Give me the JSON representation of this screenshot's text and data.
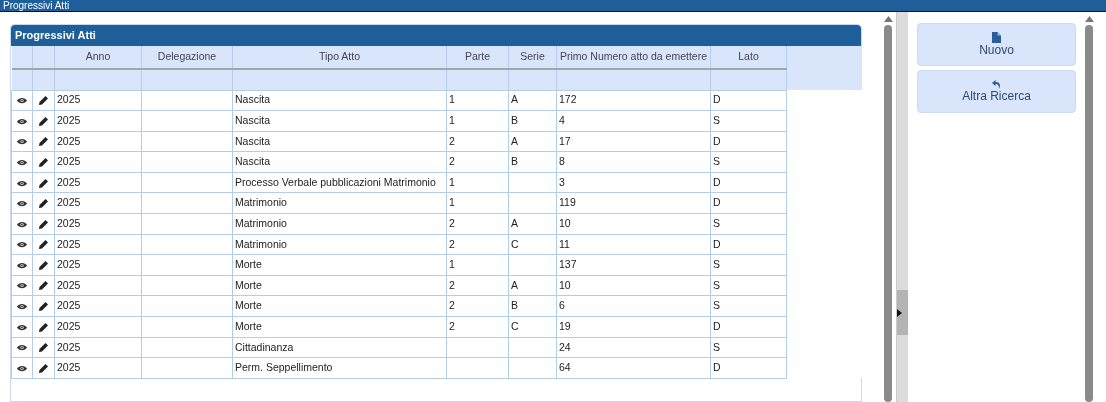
{
  "window": {
    "title": "Progressivi Atti"
  },
  "panel": {
    "title": "Progressivi Atti"
  },
  "table": {
    "columns": [
      "Anno",
      "Delegazione",
      "Tipo Atto",
      "Parte",
      "Serie",
      "Primo Numero atto da emettere",
      "Lato"
    ],
    "rows": [
      {
        "anno": "2025",
        "tipo_atto": "Nascita",
        "parte": "1",
        "serie": "A",
        "primo_numero": "172",
        "lato": "D"
      },
      {
        "anno": "2025",
        "tipo_atto": "Nascita",
        "parte": "1",
        "serie": "B",
        "primo_numero": "4",
        "lato": "S"
      },
      {
        "anno": "2025",
        "tipo_atto": "Nascita",
        "parte": "2",
        "serie": "A",
        "primo_numero": "17",
        "lato": "D"
      },
      {
        "anno": "2025",
        "tipo_atto": "Nascita",
        "parte": "2",
        "serie": "B",
        "primo_numero": "8",
        "lato": "S"
      },
      {
        "anno": "2025",
        "tipo_atto": "Processo Verbale pubblicazioni Matrimonio",
        "parte": "1",
        "primo_numero": "3",
        "lato": "D"
      },
      {
        "anno": "2025",
        "tipo_atto": "Matrimonio",
        "parte": "1",
        "primo_numero": "119",
        "lato": "D"
      },
      {
        "anno": "2025",
        "tipo_atto": "Matrimonio",
        "parte": "2",
        "serie": "A",
        "primo_numero": "10",
        "lato": "S"
      },
      {
        "anno": "2025",
        "tipo_atto": "Matrimonio",
        "parte": "2",
        "serie": "C",
        "primo_numero": "11",
        "lato": "D"
      },
      {
        "anno": "2025",
        "tipo_atto": "Morte",
        "parte": "1",
        "primo_numero": "137",
        "lato": "S"
      },
      {
        "anno": "2025",
        "tipo_atto": "Morte",
        "parte": "2",
        "serie": "A",
        "primo_numero": "10",
        "lato": "S"
      },
      {
        "anno": "2025",
        "tipo_atto": "Morte",
        "parte": "2",
        "serie": "B",
        "primo_numero": "6",
        "lato": "S"
      },
      {
        "anno": "2025",
        "tipo_atto": "Morte",
        "parte": "2",
        "serie": "C",
        "primo_numero": "19",
        "lato": "D"
      },
      {
        "anno": "2025",
        "tipo_atto": "Cittadinanza",
        "primo_numero": "24",
        "lato": "S"
      },
      {
        "anno": "2025",
        "tipo_atto": "Perm. Seppellimento",
        "primo_numero": "64",
        "lato": "D"
      }
    ]
  },
  "actions": [
    {
      "kind": "new",
      "label": "Nuovo"
    },
    {
      "kind": "back",
      "label": "Altra Ricerca"
    }
  ]
}
